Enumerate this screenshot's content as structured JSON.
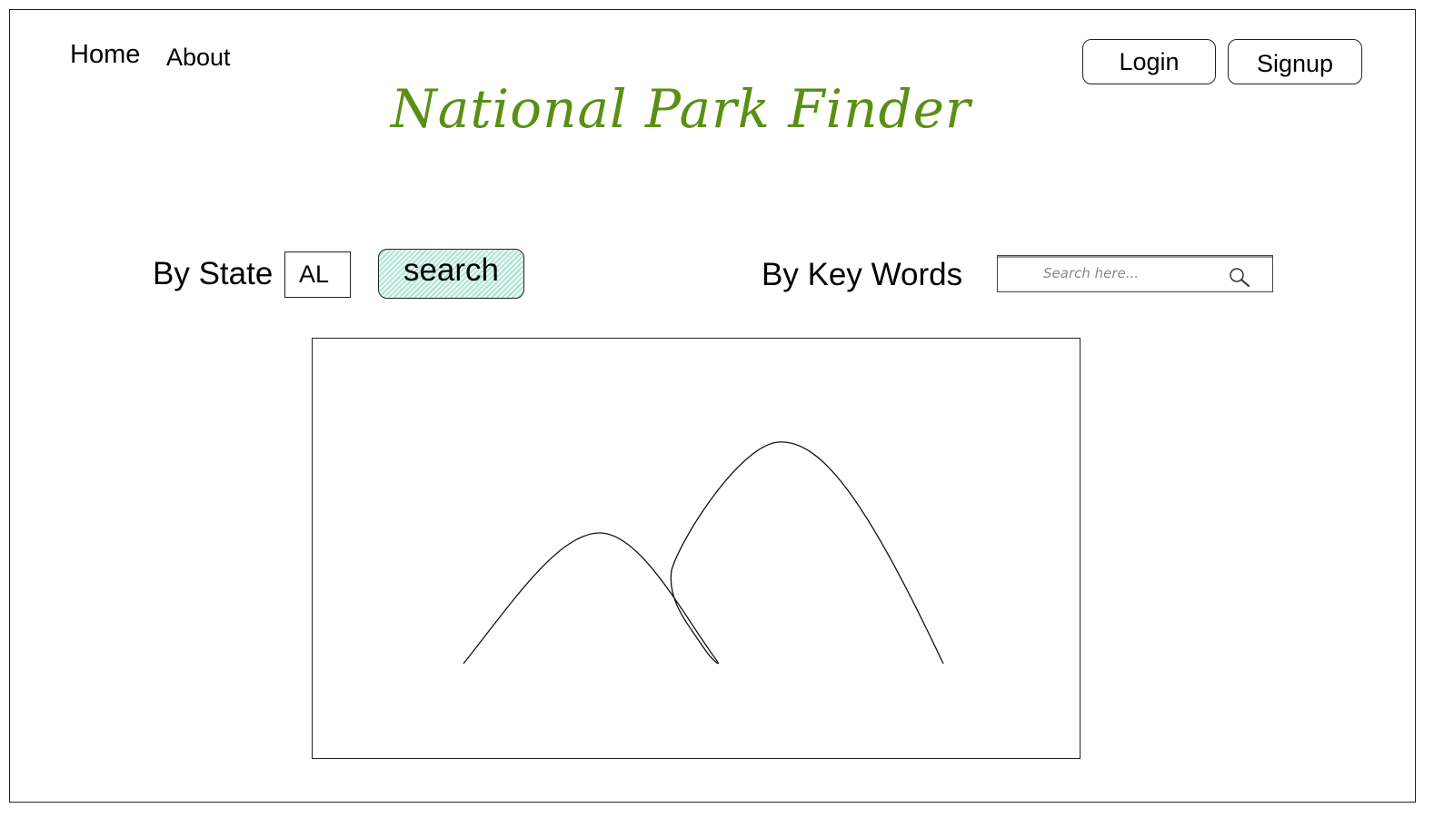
{
  "nav": {
    "home_label": "Home",
    "about_label": "About"
  },
  "auth": {
    "login_label": "Login",
    "signup_label": "Signup"
  },
  "header": {
    "title": "National Park Finder",
    "title_color": "#5b8f14"
  },
  "search": {
    "by_state_label": "By State",
    "state_value": "AL",
    "search_button_label": "search",
    "search_button_color": "#a6e0d1",
    "by_keywords_label": "By Key Words",
    "keyword_placeholder": "Search here...",
    "keyword_icon": "search-icon"
  },
  "main": {
    "image_icon": "mountain-image-placeholder"
  }
}
